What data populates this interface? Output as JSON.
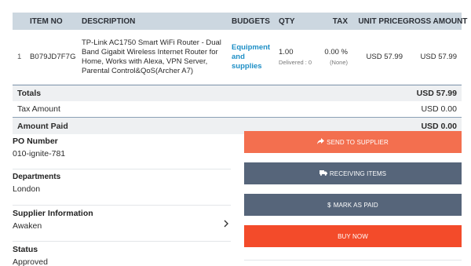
{
  "table": {
    "headers": {
      "item_no": "ITEM NO",
      "description": "DESCRIPTION",
      "budgets": "BUDGETS",
      "qty": "QTY",
      "tax": "TAX",
      "unit_price": "UNIT PRICE",
      "gross_amount": "GROSS AMOUNT"
    },
    "rows": [
      {
        "num": "1",
        "item_no": "B079JD7F7G",
        "description": "TP-Link AC1750 Smart WiFi Router - Dual Band Gigabit Wireless Internet Router for Home, Works with Alexa, VPN Server, Parental Control&QoS(Archer A7)",
        "budget": "Equipment and supplies",
        "qty": "1.00",
        "qty_sub": "Delivered : 0",
        "tax": "0.00 %",
        "tax_sub": "(None)",
        "unit_price": "USD 57.99",
        "gross_amount": "USD 57.99"
      }
    ]
  },
  "summary": {
    "totals_label": "Totals",
    "totals_value": "USD 57.99",
    "tax_label": "Tax Amount",
    "tax_value": "USD 0.00",
    "paid_label": "Amount Paid",
    "paid_value": "USD 0.00"
  },
  "details": {
    "po_number_label": "PO Number",
    "po_number_value": "010-ignite-781",
    "departments_label": "Departments",
    "departments_value": "London",
    "supplier_label": "Supplier Information",
    "supplier_value": "Awaken",
    "status_label": "Status",
    "status_value": "Approved"
  },
  "actions": {
    "send_to_supplier": "SEND TO SUPPLIER",
    "receiving_items": "RECEIVING ITEMS",
    "mark_as_paid": "MARK AS PAID",
    "buy_now": "BUY NOW"
  },
  "icons": {
    "send": "share-arrow-icon",
    "receiving": "truck-icon",
    "paid": "dollar-icon",
    "supplier_chevron": "chevron-right-icon"
  },
  "colors": {
    "header_bg": "#ccd7e0",
    "budget_link": "#1e8fc6",
    "send_button": "#f36f4f",
    "slate_button": "#56657a",
    "buy_button": "#f34b2a"
  }
}
